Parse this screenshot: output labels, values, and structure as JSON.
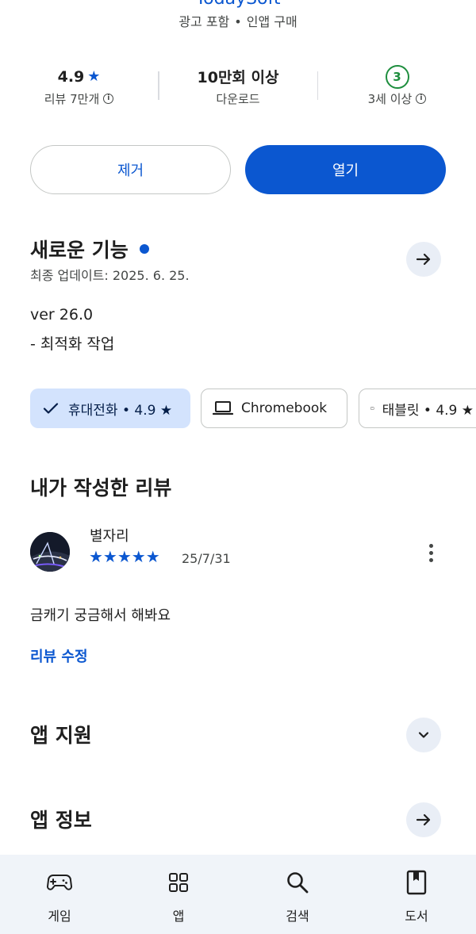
{
  "header": {
    "developer": "TodaySoft",
    "meta_ads": "광고 포함",
    "meta_sep": "•",
    "meta_iap": "인앱 구매"
  },
  "stats": {
    "rating_value": "4.9",
    "rating_star": "★",
    "rating_label": "리뷰 7만개",
    "downloads_value": "10만회 이상",
    "downloads_label": "다운로드",
    "age_badge": "3",
    "age_label": "3세 이상"
  },
  "actions": {
    "remove_label": "제거",
    "open_label": "열기"
  },
  "whats_new": {
    "title": "새로운 기능",
    "updated": "최종 업데이트: 2025. 6. 25.",
    "version": "ver 26.0",
    "notes": "- 최적화 작업"
  },
  "device_chips": [
    {
      "label": "휴대전화 • 4.9 ★",
      "icon": "check-icon",
      "selected": true
    },
    {
      "label": "Chromebook",
      "icon": "laptop-icon",
      "selected": false
    },
    {
      "label": "태블릿 • 4.9 ★",
      "icon": "tablet-icon",
      "selected": false
    }
  ],
  "my_review": {
    "section_title": "내가 작성한 리뷰",
    "reviewer_name": "별자리",
    "stars": "★★★★★",
    "rating": 5,
    "date": "25/7/31",
    "text": "금캐기 궁금해서 해봐요",
    "edit_label": "리뷰 수정"
  },
  "app_support": {
    "title": "앱 지원"
  },
  "app_info": {
    "title": "앱 정보"
  },
  "bottom_nav": [
    {
      "label": "게임",
      "icon": "gamepad-icon"
    },
    {
      "label": "앱",
      "icon": "apps-grid-icon"
    },
    {
      "label": "검색",
      "icon": "search-icon"
    },
    {
      "label": "도서",
      "icon": "book-icon"
    }
  ],
  "colors": {
    "accent": "#0b57d0",
    "chip_selected_bg": "#d3e3fd",
    "age_green": "#1e8e3e",
    "nav_bg": "#f0f4f9"
  }
}
